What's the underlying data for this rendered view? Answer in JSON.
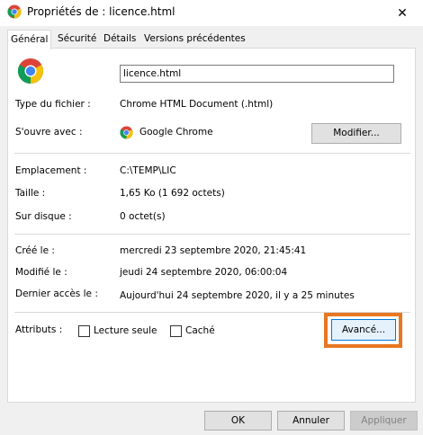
{
  "window": {
    "title": "Propriétés de : licence.html",
    "close_glyph": "✕"
  },
  "tabs": [
    {
      "label": "Général",
      "active": true
    },
    {
      "label": "Sécurité",
      "active": false
    },
    {
      "label": "Détails",
      "active": false
    },
    {
      "label": "Versions précédentes",
      "active": false
    }
  ],
  "general": {
    "file_name": "licence.html",
    "file_type_label": "Type du fichier :",
    "file_type_value": "Chrome HTML Document (.html)",
    "opens_with_label": "S'ouvre avec :",
    "opens_with_value": "Google Chrome",
    "change_button": "Modifier...",
    "location_label": "Emplacement :",
    "location_value": "C:\\TEMP\\LIC",
    "size_label": "Taille :",
    "size_value": "1,65 Ko (1 692 octets)",
    "size_on_disk_label": "Sur disque :",
    "size_on_disk_value": "0 octet(s)",
    "created_label": "Créé le :",
    "created_value": "mercredi 23 septembre 2020, 21:45:41",
    "modified_label": "Modifié le :",
    "modified_value": "jeudi 24 septembre 2020, 06:00:04",
    "accessed_label": "Dernier accès le :",
    "accessed_value": "Aujourd'hui 24 septembre 2020, il y a 25 minutes",
    "attributes_label": "Attributs :",
    "readonly_label": "Lecture seule",
    "hidden_label": "Caché",
    "advanced_button": "Avancé..."
  },
  "footer": {
    "ok": "OK",
    "cancel": "Annuler",
    "apply": "Appliquer"
  },
  "colors": {
    "highlight_border": "#e87722",
    "chrome_red": "#db4437",
    "chrome_yellow": "#f4c20d",
    "chrome_green": "#0f9d58",
    "chrome_blue": "#4285f4"
  },
  "icons": [
    "chrome-icon",
    "close-icon"
  ]
}
